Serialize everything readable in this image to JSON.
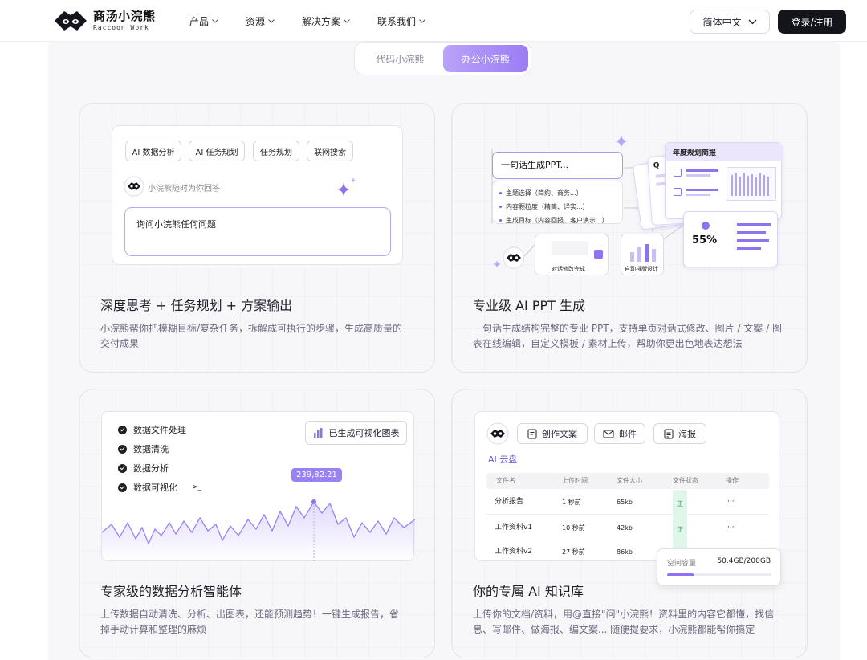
{
  "header": {
    "brand_cn": "商汤小浣熊",
    "brand_en": "Raccoon Work",
    "nav": [
      "产品",
      "资源",
      "解决方案",
      "联系我们"
    ],
    "language": "简体中文",
    "login": "登录/注册"
  },
  "tabs": [
    "代码小浣熊",
    "办公小浣熊"
  ],
  "active_tab": 1,
  "cards": [
    {
      "title": "深度思考 + 任务规划 + 方案输出",
      "desc1": "小浣熊帮你把模糊目标/复杂任务，拆解成可执行的步骤，生成高质量的",
      "desc2": "交付成果",
      "chips": [
        "AI 数据分析",
        "AI 任务规划",
        "任务规划",
        "联网搜索"
      ],
      "assistant_hint": "小浣熊随时为你回答",
      "ask_placeholder": "询问小浣熊任何问题"
    },
    {
      "title": "专业级 AI PPT 生成",
      "desc1": "一句话生成结构完整的专业 PPT，支持单页对话式修改、图片 / 文案 / 图",
      "desc2": "表在线编辑，自定义模板 / 素材上传，帮助你更出色地表达想法",
      "prompt": "一句话生成PPT...",
      "options": [
        "主题选择（简约、商务...）",
        "内容颗粒度（精简、详实...）",
        "生成目标（内容回报、客户演示...）"
      ],
      "edit_done": "对话修改完成",
      "auto_layout": "自动排版设计",
      "slide_title": "年度规划简报",
      "slide_mark": "Q",
      "percent": "55%"
    },
    {
      "title": "专家级的数据分析智能体",
      "desc1": "上传数据自动清洗、分析、出图表，还能预测趋势！一键生成报告，省",
      "desc2": "掉手动计算和整理的麻烦",
      "steps": [
        "数据文件处理",
        "数据清洗",
        "数据分析",
        "数据可视化"
      ],
      "cursor": ">_",
      "viz_button": "已生成可视化图表",
      "peak_label": "239,82.21"
    },
    {
      "title": "你的专属 AI 知识库",
      "desc1": "上传你的文档/资料，用@直接\"问\"小浣熊！资料里的内容它都懂，找信",
      "desc2": "息、写邮件、做海报、编文案... 随便提要求，小浣熊都能帮你搞定",
      "buttons": [
        "创作文案",
        "邮件",
        "海报"
      ],
      "drive": "AI 云盘",
      "columns": [
        "文件名",
        "上传时间",
        "文件大小",
        "文件状态",
        "操作"
      ],
      "rows": [
        {
          "name": "分析报告",
          "time": "1 秒前",
          "size": "65kb",
          "status": "正常",
          "op": "···"
        },
        {
          "name": "工作资料v1",
          "time": "10 秒前",
          "size": "42kb",
          "status": "正常",
          "op": "···"
        },
        {
          "name": "工作资料v2",
          "time": "27 秒前",
          "size": "86kb",
          "status": "",
          "op": ""
        }
      ],
      "capacity_label": "空间容量",
      "capacity_value": "50.4GB/200GB",
      "capacity_fraction": 0.25
    }
  ]
}
